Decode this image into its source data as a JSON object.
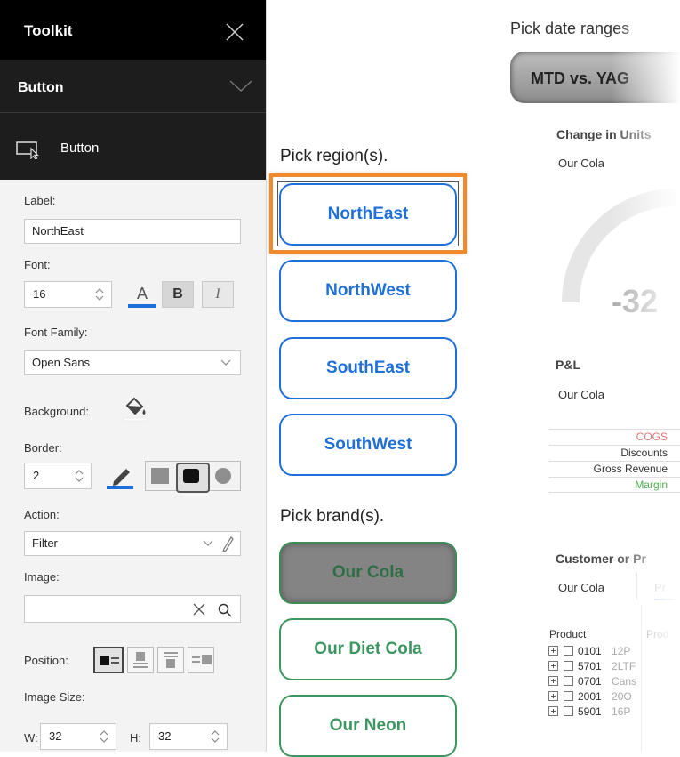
{
  "toolkit": {
    "title": "Toolkit",
    "section": "Button",
    "sub_title": "Button",
    "label_caption": "Label:",
    "label_value": "NorthEast",
    "font_caption": "Font:",
    "font_size": "16",
    "font_color_glyph": "A",
    "bold_glyph": "B",
    "italic_glyph": "I",
    "font_family_caption": "Font Family:",
    "font_family_value": "Open Sans",
    "background_caption": "Background:",
    "border_caption": "Border:",
    "border_size": "2",
    "action_caption": "Action:",
    "action_value": "Filter",
    "image_caption": "Image:",
    "image_value": "",
    "position_caption": "Position:",
    "image_size_caption": "Image Size:",
    "w_caption": "W:",
    "w_value": "32",
    "h_caption": "H:",
    "h_value": "32",
    "accent": "#1e6fd9"
  },
  "canvas": {
    "pick_region_label": "Pick region(s).",
    "regions": [
      "NorthEast",
      "NorthWest",
      "SouthEast",
      "SouthWest"
    ],
    "pick_brand_label": "Pick brand(s).",
    "brands": [
      "Our Cola",
      "Our Diet Cola",
      "Our Neon"
    ],
    "region_color": "#1e6fd9",
    "brand_color": "#3d9660",
    "highlight_color": "#f08a2c"
  },
  "dashboard": {
    "date_label": "Pick date ranges",
    "date_button": "MTD vs. YAG",
    "units_title": "Change in Units",
    "units_sub": "Our Cola",
    "gauge_value": "-32",
    "pl_title": "P&L",
    "pl_sub": "Our Cola",
    "pl_rows": [
      "COGS",
      "Discounts",
      "Gross Revenue",
      "Margin"
    ],
    "cust_title": "Customer or Pr",
    "cust_tab1": "Our Cola",
    "cust_tab2": "Pr",
    "product_header": "Product",
    "product_header2": "Prod",
    "products": [
      {
        "code": "0101",
        "name": "12P"
      },
      {
        "code": "5701",
        "name": "2LTF"
      },
      {
        "code": "0701",
        "name": "Cans"
      },
      {
        "code": "2001",
        "name": "20O"
      },
      {
        "code": "5901",
        "name": "16P"
      }
    ]
  }
}
